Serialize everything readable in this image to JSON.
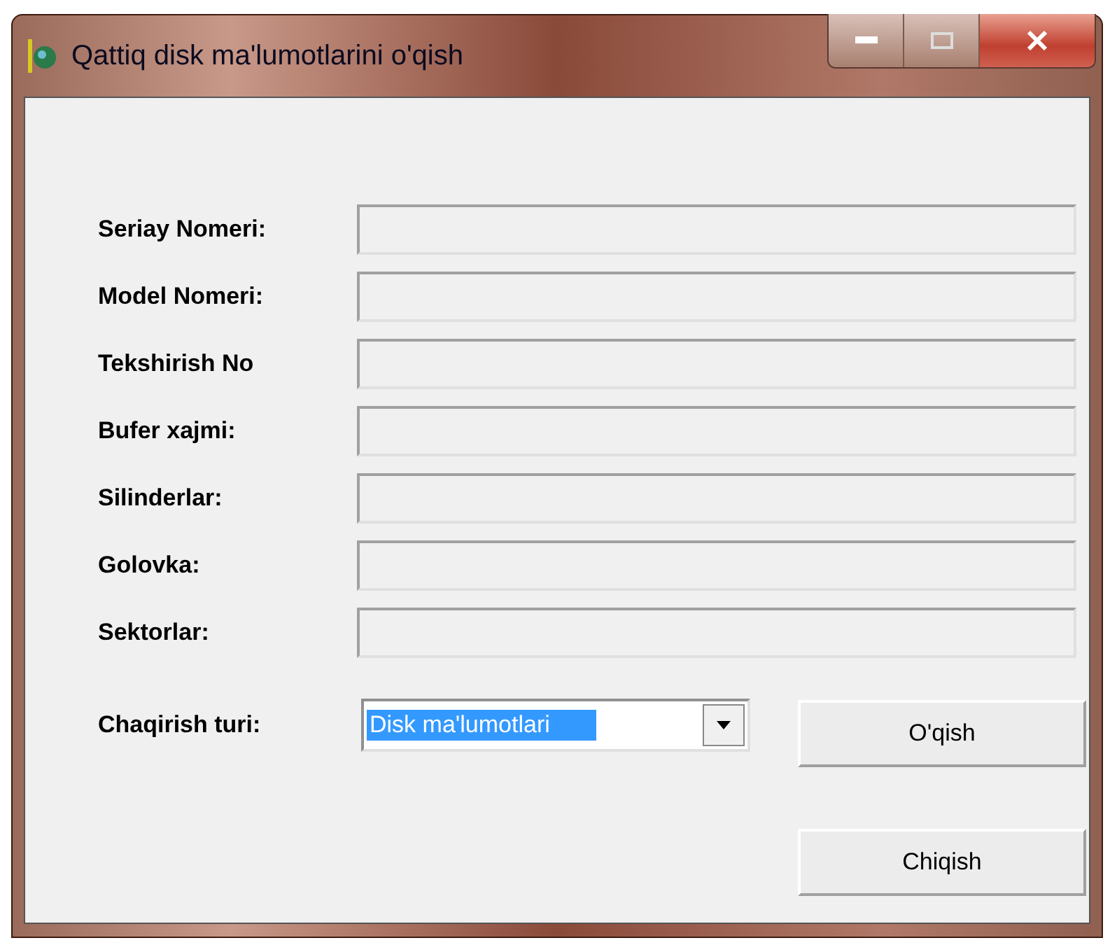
{
  "window": {
    "title": "Qattiq disk ma'lumotlarini o'qish"
  },
  "fields": [
    {
      "label": "Seriay Nomeri:"
    },
    {
      "label": "Model Nomeri:"
    },
    {
      "label": "Tekshirish No"
    },
    {
      "label": "Bufer xajmi:"
    },
    {
      "label": "Silinderlar:"
    },
    {
      "label": "Golovka:"
    },
    {
      "label": "Sektorlar:"
    }
  ],
  "call_type": {
    "label": "Chaqirish turi:",
    "value": "Disk ma'lumotlari"
  },
  "buttons": [
    "O'qish",
    "Chiqish"
  ]
}
